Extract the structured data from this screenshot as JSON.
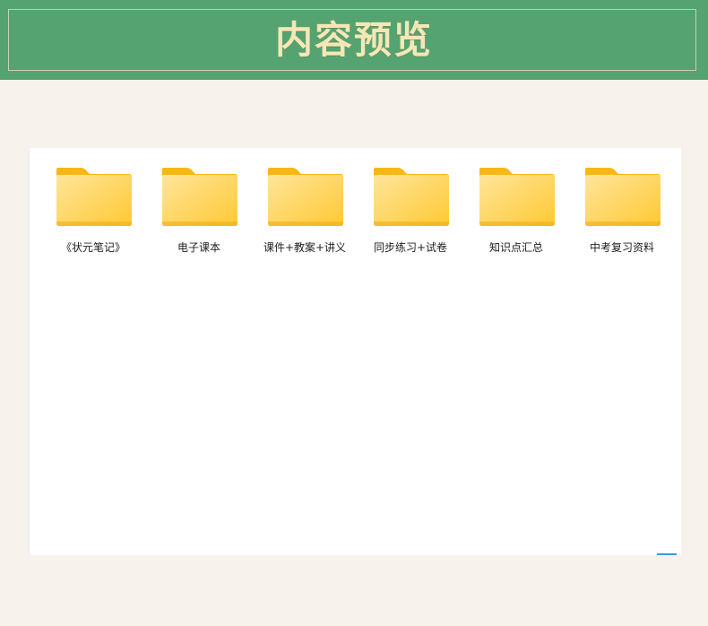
{
  "header": {
    "title": "内容预览"
  },
  "folders": [
    {
      "label": "《状元笔记》",
      "icon": "folder-icon"
    },
    {
      "label": "电子课本",
      "icon": "folder-icon"
    },
    {
      "label": "课件+教案+讲义",
      "icon": "folder-icon"
    },
    {
      "label": "同步练习+试卷",
      "icon": "folder-icon"
    },
    {
      "label": "知识点汇总",
      "icon": "folder-icon"
    },
    {
      "label": "中考复习资料",
      "icon": "folder-icon"
    }
  ],
  "colors": {
    "header_bg": "#56a372",
    "title": "#f6e7b6",
    "page_bg": "#f7f3ec",
    "folder_back": "#f7b716",
    "folder_front": "#ffd867"
  }
}
